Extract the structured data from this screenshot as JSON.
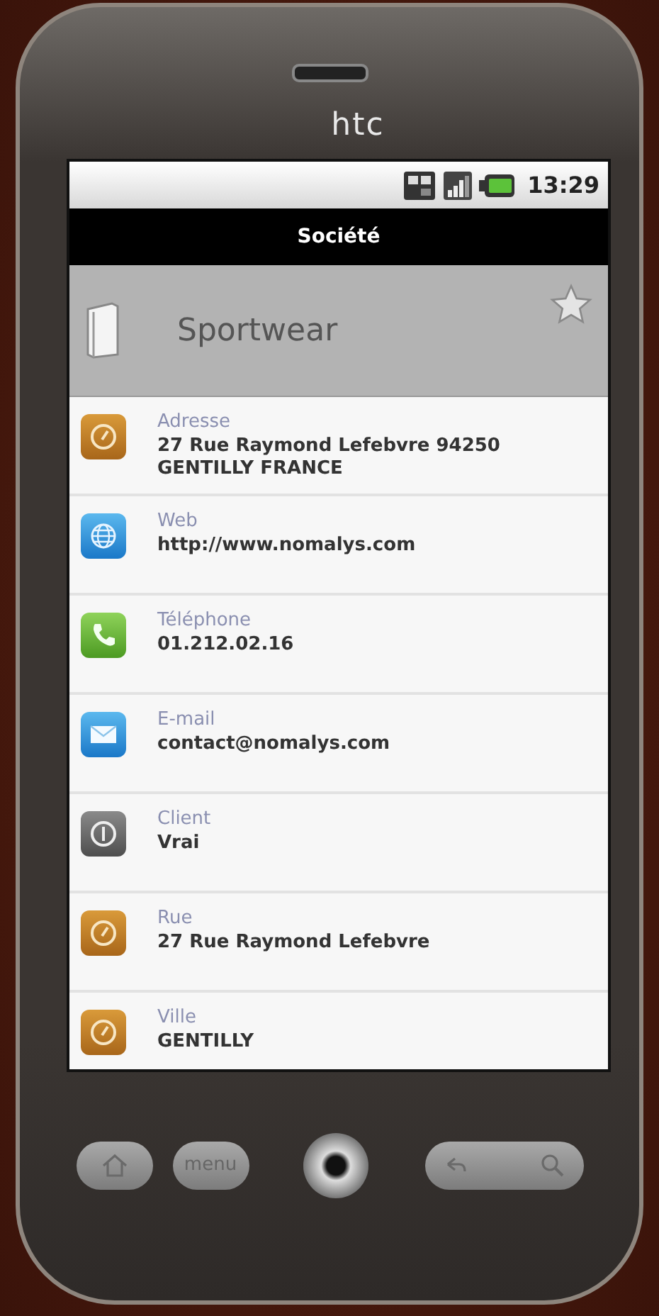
{
  "device": {
    "brand": "htc",
    "menu_key": "menu"
  },
  "status_bar": {
    "time": "13:29"
  },
  "title_bar": {
    "title": "Société"
  },
  "header": {
    "name": "Sportwear",
    "favorite": false
  },
  "fields": [
    {
      "kind": "address",
      "label": "Adresse",
      "value": "27 Rue Raymond Lefebvre 94250 GENTILLY FRANCE"
    },
    {
      "kind": "web",
      "label": "Web",
      "value": "http://www.nomalys.com"
    },
    {
      "kind": "phone",
      "label": "Téléphone",
      "value": "01.212.02.16"
    },
    {
      "kind": "email",
      "label": "E-mail",
      "value": "contact@nomalys.com"
    },
    {
      "kind": "info",
      "label": "Client",
      "value": "Vrai"
    },
    {
      "kind": "address",
      "label": "Rue",
      "value": "27 Rue Raymond Lefebvre"
    },
    {
      "kind": "address",
      "label": "Ville",
      "value": "GENTILLY"
    }
  ]
}
